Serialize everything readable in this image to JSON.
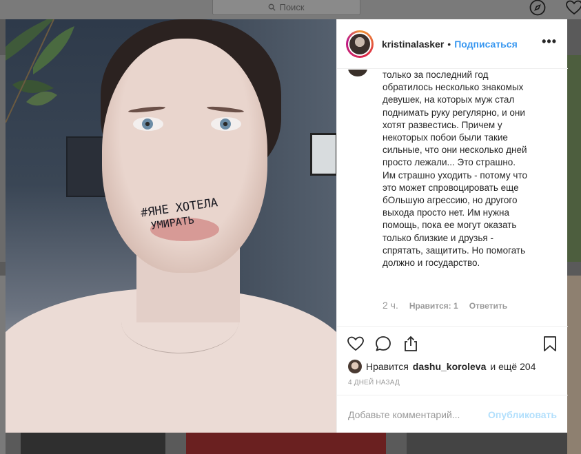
{
  "topbar": {
    "search_placeholder": "Поиск",
    "icons": [
      "search-icon",
      "compass-icon",
      "heart-icon"
    ]
  },
  "post": {
    "photo": {
      "mouth_text_line1": "#ЯНЕ ХОТЕЛА",
      "mouth_text_line2": "УМИРАТЬ"
    },
    "header": {
      "username": "kristinalasker",
      "separator": "•",
      "follow_label": "Подписаться",
      "more_label": "•••"
    },
    "comment": {
      "text": "только за последний год обратилось несколько знакомых девушек, на которых муж стал поднимать руку регулярно, и они хотят развестись. Причем у некоторых побои были такие сильные, что они несколько дней просто лежали... Это страшно. Им страшно уходить - потому что это может спровоцировать еще бОльшую агрессию, но другого выхода просто нет. Им нужна помощь, пока ее могут оказать только близкие и друзья - спрятать, защитить. Но помогать должно и государство.",
      "time": "2 ч.",
      "likes": "Нравится: 1",
      "reply": "Ответить"
    },
    "actions": {
      "icons": [
        "heart-icon",
        "comment-icon",
        "share-icon",
        "bookmark-icon"
      ]
    },
    "likes_summary": {
      "prefix": "Нравится",
      "user": "dashu_koroleva",
      "suffix": "и ещё 204"
    },
    "date": "4 ДНЕЙ НАЗАД",
    "add_comment": {
      "placeholder": "Добавьте комментарий...",
      "publish_label": "Опубликовать"
    }
  },
  "colors": {
    "accent": "#3897f0",
    "publish_disabled": "#b2dffc",
    "text": "#262626",
    "muted": "#999999"
  }
}
